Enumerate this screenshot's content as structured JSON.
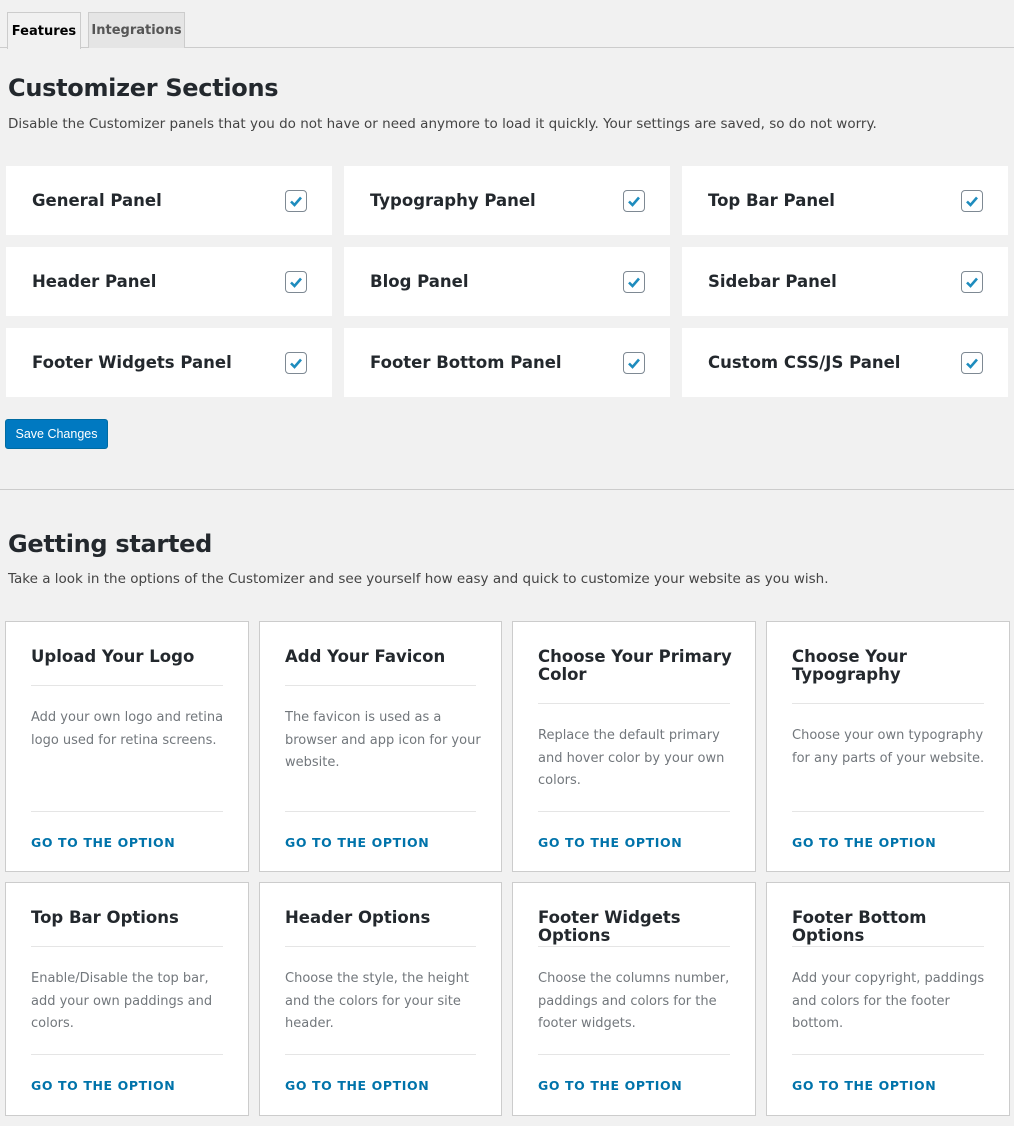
{
  "tabs": [
    {
      "label": "Features",
      "active": true
    },
    {
      "label": "Integrations",
      "active": false
    }
  ],
  "customizer": {
    "title": "Customizer Sections",
    "description": "Disable the Customizer panels that you do not have or need anymore to load it quickly. Your settings are saved, so do not worry.",
    "panels": [
      {
        "label": "General Panel",
        "checked": true
      },
      {
        "label": "Typography Panel",
        "checked": true
      },
      {
        "label": "Top Bar Panel",
        "checked": true
      },
      {
        "label": "Header Panel",
        "checked": true
      },
      {
        "label": "Blog Panel",
        "checked": true
      },
      {
        "label": "Sidebar Panel",
        "checked": true
      },
      {
        "label": "Footer Widgets Panel",
        "checked": true
      },
      {
        "label": "Footer Bottom Panel",
        "checked": true
      },
      {
        "label": "Custom CSS/JS Panel",
        "checked": true
      }
    ],
    "save_label": "Save Changes"
  },
  "getting_started": {
    "title": "Getting started",
    "description": "Take a look in the options of the Customizer and see yourself how easy and quick to customize your website as you wish.",
    "link_label": "GO TO THE OPTION",
    "cards": [
      {
        "title": "Upload Your Logo",
        "description": "Add your own logo and retina logo used for retina screens."
      },
      {
        "title": "Add Your Favicon",
        "description": "The favicon is used as a browser and app icon for your website."
      },
      {
        "title": "Choose Your Primary Color",
        "description": "Replace the default primary and hover color by your own colors."
      },
      {
        "title": "Choose Your Typography",
        "description": "Choose your own typography for any parts of your website."
      },
      {
        "title": "Top Bar Options",
        "description": "Enable/Disable the top bar, add your own paddings and colors."
      },
      {
        "title": "Header Options",
        "description": "Choose the style, the height and the colors for your site header."
      },
      {
        "title": "Footer Widgets Options",
        "description": "Choose the columns number, paddings and colors for the footer widgets."
      },
      {
        "title": "Footer Bottom Options",
        "description": "Add your copyright, paddings and colors for the footer bottom."
      }
    ]
  },
  "colors": {
    "accent": "#0073aa",
    "button": "#0079c1",
    "check": "#1e8cbe",
    "background": "#f1f1f1"
  }
}
